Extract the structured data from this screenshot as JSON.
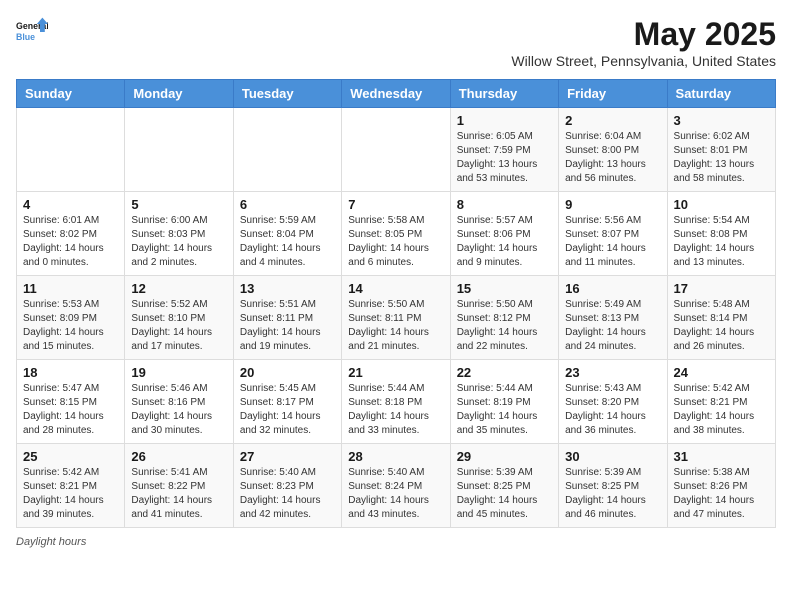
{
  "logo": {
    "line1": "General",
    "line2": "Blue"
  },
  "title": "May 2025",
  "subtitle": "Willow Street, Pennsylvania, United States",
  "days_of_week": [
    "Sunday",
    "Monday",
    "Tuesday",
    "Wednesday",
    "Thursday",
    "Friday",
    "Saturday"
  ],
  "weeks": [
    [
      {
        "day": "",
        "detail": ""
      },
      {
        "day": "",
        "detail": ""
      },
      {
        "day": "",
        "detail": ""
      },
      {
        "day": "",
        "detail": ""
      },
      {
        "day": "1",
        "detail": "Sunrise: 6:05 AM\nSunset: 7:59 PM\nDaylight: 13 hours\nand 53 minutes."
      },
      {
        "day": "2",
        "detail": "Sunrise: 6:04 AM\nSunset: 8:00 PM\nDaylight: 13 hours\nand 56 minutes."
      },
      {
        "day": "3",
        "detail": "Sunrise: 6:02 AM\nSunset: 8:01 PM\nDaylight: 13 hours\nand 58 minutes."
      }
    ],
    [
      {
        "day": "4",
        "detail": "Sunrise: 6:01 AM\nSunset: 8:02 PM\nDaylight: 14 hours\nand 0 minutes."
      },
      {
        "day": "5",
        "detail": "Sunrise: 6:00 AM\nSunset: 8:03 PM\nDaylight: 14 hours\nand 2 minutes."
      },
      {
        "day": "6",
        "detail": "Sunrise: 5:59 AM\nSunset: 8:04 PM\nDaylight: 14 hours\nand 4 minutes."
      },
      {
        "day": "7",
        "detail": "Sunrise: 5:58 AM\nSunset: 8:05 PM\nDaylight: 14 hours\nand 6 minutes."
      },
      {
        "day": "8",
        "detail": "Sunrise: 5:57 AM\nSunset: 8:06 PM\nDaylight: 14 hours\nand 9 minutes."
      },
      {
        "day": "9",
        "detail": "Sunrise: 5:56 AM\nSunset: 8:07 PM\nDaylight: 14 hours\nand 11 minutes."
      },
      {
        "day": "10",
        "detail": "Sunrise: 5:54 AM\nSunset: 8:08 PM\nDaylight: 14 hours\nand 13 minutes."
      }
    ],
    [
      {
        "day": "11",
        "detail": "Sunrise: 5:53 AM\nSunset: 8:09 PM\nDaylight: 14 hours\nand 15 minutes."
      },
      {
        "day": "12",
        "detail": "Sunrise: 5:52 AM\nSunset: 8:10 PM\nDaylight: 14 hours\nand 17 minutes."
      },
      {
        "day": "13",
        "detail": "Sunrise: 5:51 AM\nSunset: 8:11 PM\nDaylight: 14 hours\nand 19 minutes."
      },
      {
        "day": "14",
        "detail": "Sunrise: 5:50 AM\nSunset: 8:11 PM\nDaylight: 14 hours\nand 21 minutes."
      },
      {
        "day": "15",
        "detail": "Sunrise: 5:50 AM\nSunset: 8:12 PM\nDaylight: 14 hours\nand 22 minutes."
      },
      {
        "day": "16",
        "detail": "Sunrise: 5:49 AM\nSunset: 8:13 PM\nDaylight: 14 hours\nand 24 minutes."
      },
      {
        "day": "17",
        "detail": "Sunrise: 5:48 AM\nSunset: 8:14 PM\nDaylight: 14 hours\nand 26 minutes."
      }
    ],
    [
      {
        "day": "18",
        "detail": "Sunrise: 5:47 AM\nSunset: 8:15 PM\nDaylight: 14 hours\nand 28 minutes."
      },
      {
        "day": "19",
        "detail": "Sunrise: 5:46 AM\nSunset: 8:16 PM\nDaylight: 14 hours\nand 30 minutes."
      },
      {
        "day": "20",
        "detail": "Sunrise: 5:45 AM\nSunset: 8:17 PM\nDaylight: 14 hours\nand 32 minutes."
      },
      {
        "day": "21",
        "detail": "Sunrise: 5:44 AM\nSunset: 8:18 PM\nDaylight: 14 hours\nand 33 minutes."
      },
      {
        "day": "22",
        "detail": "Sunrise: 5:44 AM\nSunset: 8:19 PM\nDaylight: 14 hours\nand 35 minutes."
      },
      {
        "day": "23",
        "detail": "Sunrise: 5:43 AM\nSunset: 8:20 PM\nDaylight: 14 hours\nand 36 minutes."
      },
      {
        "day": "24",
        "detail": "Sunrise: 5:42 AM\nSunset: 8:21 PM\nDaylight: 14 hours\nand 38 minutes."
      }
    ],
    [
      {
        "day": "25",
        "detail": "Sunrise: 5:42 AM\nSunset: 8:21 PM\nDaylight: 14 hours\nand 39 minutes."
      },
      {
        "day": "26",
        "detail": "Sunrise: 5:41 AM\nSunset: 8:22 PM\nDaylight: 14 hours\nand 41 minutes."
      },
      {
        "day": "27",
        "detail": "Sunrise: 5:40 AM\nSunset: 8:23 PM\nDaylight: 14 hours\nand 42 minutes."
      },
      {
        "day": "28",
        "detail": "Sunrise: 5:40 AM\nSunset: 8:24 PM\nDaylight: 14 hours\nand 43 minutes."
      },
      {
        "day": "29",
        "detail": "Sunrise: 5:39 AM\nSunset: 8:25 PM\nDaylight: 14 hours\nand 45 minutes."
      },
      {
        "day": "30",
        "detail": "Sunrise: 5:39 AM\nSunset: 8:25 PM\nDaylight: 14 hours\nand 46 minutes."
      },
      {
        "day": "31",
        "detail": "Sunrise: 5:38 AM\nSunset: 8:26 PM\nDaylight: 14 hours\nand 47 minutes."
      }
    ]
  ],
  "footer": {
    "label": "Daylight hours"
  }
}
